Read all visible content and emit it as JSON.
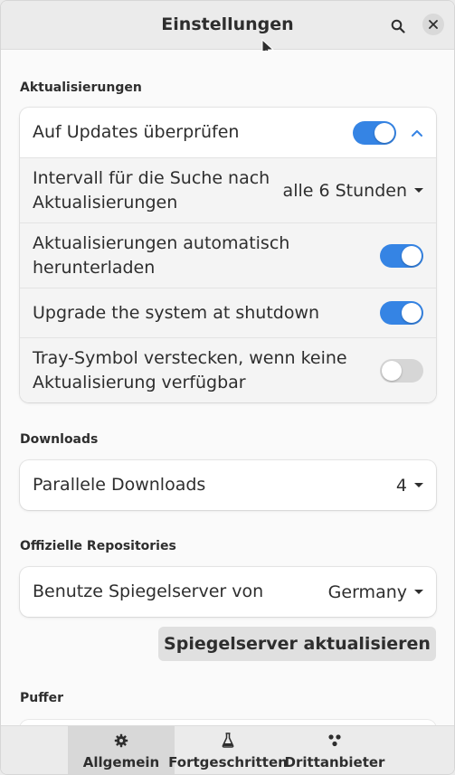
{
  "header": {
    "title": "Einstellungen",
    "search_icon": "search-icon",
    "close_icon": "close-icon"
  },
  "sections": {
    "updates": {
      "title": "Aktualisierungen",
      "check_updates_label": "Auf Updates überprüfen",
      "check_updates_on": true,
      "interval_label": "Intervall für die Suche nach Aktualisierungen",
      "interval_value": "alle 6 Stunden",
      "auto_download_label": "Aktualisierungen automatisch herunterladen",
      "auto_download_on": true,
      "upgrade_shutdown_label": "Upgrade the system at shutdown",
      "upgrade_shutdown_on": true,
      "hide_tray_label": "Tray-Symbol verstecken, wenn keine Aktualisierung verfügbar",
      "hide_tray_on": false
    },
    "downloads": {
      "title": "Downloads",
      "parallel_label": "Parallele Downloads",
      "parallel_value": "4"
    },
    "repositories": {
      "title": "Offizielle Repositories",
      "mirror_label": "Benutze Spiegelserver von",
      "mirror_value": "Germany",
      "refresh_button": "Spiegelserver aktualisieren"
    },
    "cache": {
      "title": "Puffer"
    }
  },
  "tabs": [
    {
      "label": "Allgemein",
      "icon": "gear-icon",
      "active": true
    },
    {
      "label": "Fortgeschritten",
      "icon": "flask-icon",
      "active": false
    },
    {
      "label": "Drittanbieter",
      "icon": "third-party-icon",
      "active": false
    }
  ],
  "colors": {
    "accent": "#3584e4",
    "switch_off": "#d6d6d6"
  }
}
